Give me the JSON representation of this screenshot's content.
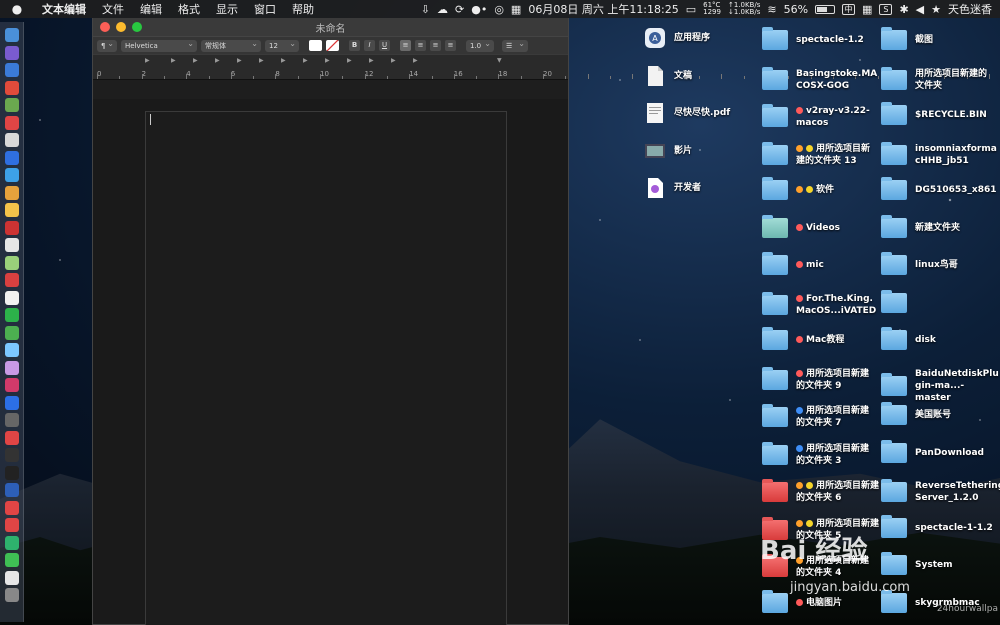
{
  "menubar": {
    "apple_icon": "apple-icon",
    "app_name": "文本编辑",
    "menus": [
      "文件",
      "编辑",
      "格式",
      "显示",
      "窗口",
      "帮助"
    ],
    "temp": "61°C",
    "fan": "1299",
    "up": "↑1.0KB/s",
    "down": "↓1.0KB/s",
    "date": "06月08日 周六 上午11:18:25",
    "battery": "56%",
    "input_method": "中",
    "user": "天色迷香"
  },
  "window": {
    "title": "未命名",
    "font_family": "Helvetica",
    "font_style": "常规体",
    "font_size": "12",
    "line_spacing": "1.0",
    "bold": "B",
    "italic": "I",
    "underline": "U",
    "paragraph": "¶",
    "list": "☰",
    "ruler_numbers": [
      "0",
      "2",
      "4",
      "6",
      "8",
      "10",
      "12",
      "14",
      "16",
      "18",
      "20"
    ]
  },
  "desktop": {
    "col1": [
      {
        "label": "应用程序",
        "icon": "applications-icon"
      },
      {
        "label": "文稿",
        "icon": "document-icon"
      },
      {
        "label": "尽快尽快.pdf",
        "icon": "pdf-icon"
      },
      {
        "label": "影片",
        "icon": "movies-icon"
      },
      {
        "label": "开发者",
        "icon": "developer-icon"
      }
    ],
    "col2": [
      {
        "label": "spectacle-1.2",
        "tags": [],
        "folder": "blue"
      },
      {
        "label": "Basingstoke.MA\nCOSX-GOG",
        "tags": [],
        "folder": "blue"
      },
      {
        "label": "v2ray-v3.22-\nmacos",
        "tags": [
          "red"
        ],
        "folder": "blue"
      },
      {
        "label": "用所选项目新\n建的文件夹 13",
        "tags": [
          "orange",
          "yellow"
        ],
        "folder": "blue"
      },
      {
        "label": "软件",
        "tags": [
          "orange",
          "yellow"
        ],
        "folder": "blue"
      },
      {
        "label": "Videos",
        "tags": [
          "red"
        ],
        "folder": "teal"
      },
      {
        "label": "mic",
        "tags": [
          "red"
        ],
        "folder": "blue"
      },
      {
        "label": "For.The.King.\nMacOS...iVATED",
        "tags": [
          "red"
        ],
        "folder": "blue"
      },
      {
        "label": "Mac教程",
        "tags": [
          "red"
        ],
        "folder": "blue"
      },
      {
        "label": "用所选项目新建\n的文件夹 9",
        "tags": [
          "red"
        ],
        "folder": "blue"
      },
      {
        "label": "用所选项目新建\n的文件夹 7",
        "tags": [
          "blue"
        ],
        "folder": "blue"
      },
      {
        "label": "用所选项目新建\n的文件夹 3",
        "tags": [
          "blue"
        ],
        "folder": "blue"
      },
      {
        "label": "用所选项目新建\n的文件夹 6",
        "tags": [
          "orange",
          "yellow"
        ],
        "folder": "red"
      },
      {
        "label": "用所选项目新建\n的文件夹 5",
        "tags": [
          "orange",
          "yellow"
        ],
        "folder": "red"
      },
      {
        "label": "用所选项目新建\n的文件夹 4",
        "tags": [
          "orange"
        ],
        "folder": "red"
      },
      {
        "label": "电脑图片",
        "tags": [
          "red"
        ],
        "folder": "blue"
      }
    ],
    "col3": [
      {
        "label": "截图"
      },
      {
        "label": "用所选项目新建的\n文件夹"
      },
      {
        "label": "$RECYCLE.BIN"
      },
      {
        "label": "insomniaxforma\ncHHB_jb51"
      },
      {
        "label": "DG510653_x861"
      },
      {
        "label": "新建文件夹"
      },
      {
        "label": "linux鸟哥"
      },
      {
        "label": ""
      },
      {
        "label": "disk"
      },
      {
        "label": "BaiduNetdiskPlu\ngin-ma...-master"
      },
      {
        "label": "美国账号"
      },
      {
        "label": "PanDownload"
      },
      {
        "label": "ReverseTethering\nServer_1.2.0"
      },
      {
        "label": "spectacle-1-1.2"
      },
      {
        "label": "System"
      },
      {
        "label": "skygrmbmac"
      }
    ]
  },
  "watermark": {
    "brand": "Bai 经验",
    "url": "jingyan.baidu.com",
    "corner": "24hourwallpa"
  },
  "dock_colors": [
    "#4a90d9",
    "#7a5bd0",
    "#3b7bd8",
    "#e14b3b",
    "#6aa84f",
    "#e04545",
    "#d8d8d8",
    "#2f6fe0",
    "#3da1e8",
    "#e6a23c",
    "#f3c34a",
    "#cc3333",
    "#e6e6e6",
    "#9ad07a",
    "#d94040",
    "#f1f1f1",
    "#2cb24a",
    "#4caf50",
    "#7cc7ff",
    "#c89ae5",
    "#d13a6a",
    "#2c6fe6",
    "#666",
    "#e04545",
    "#333",
    "#222",
    "#2d5fb8",
    "#e04545",
    "#e04545",
    "#2eb16d",
    "#3fbf54",
    "#e6e6e6",
    "#888"
  ]
}
